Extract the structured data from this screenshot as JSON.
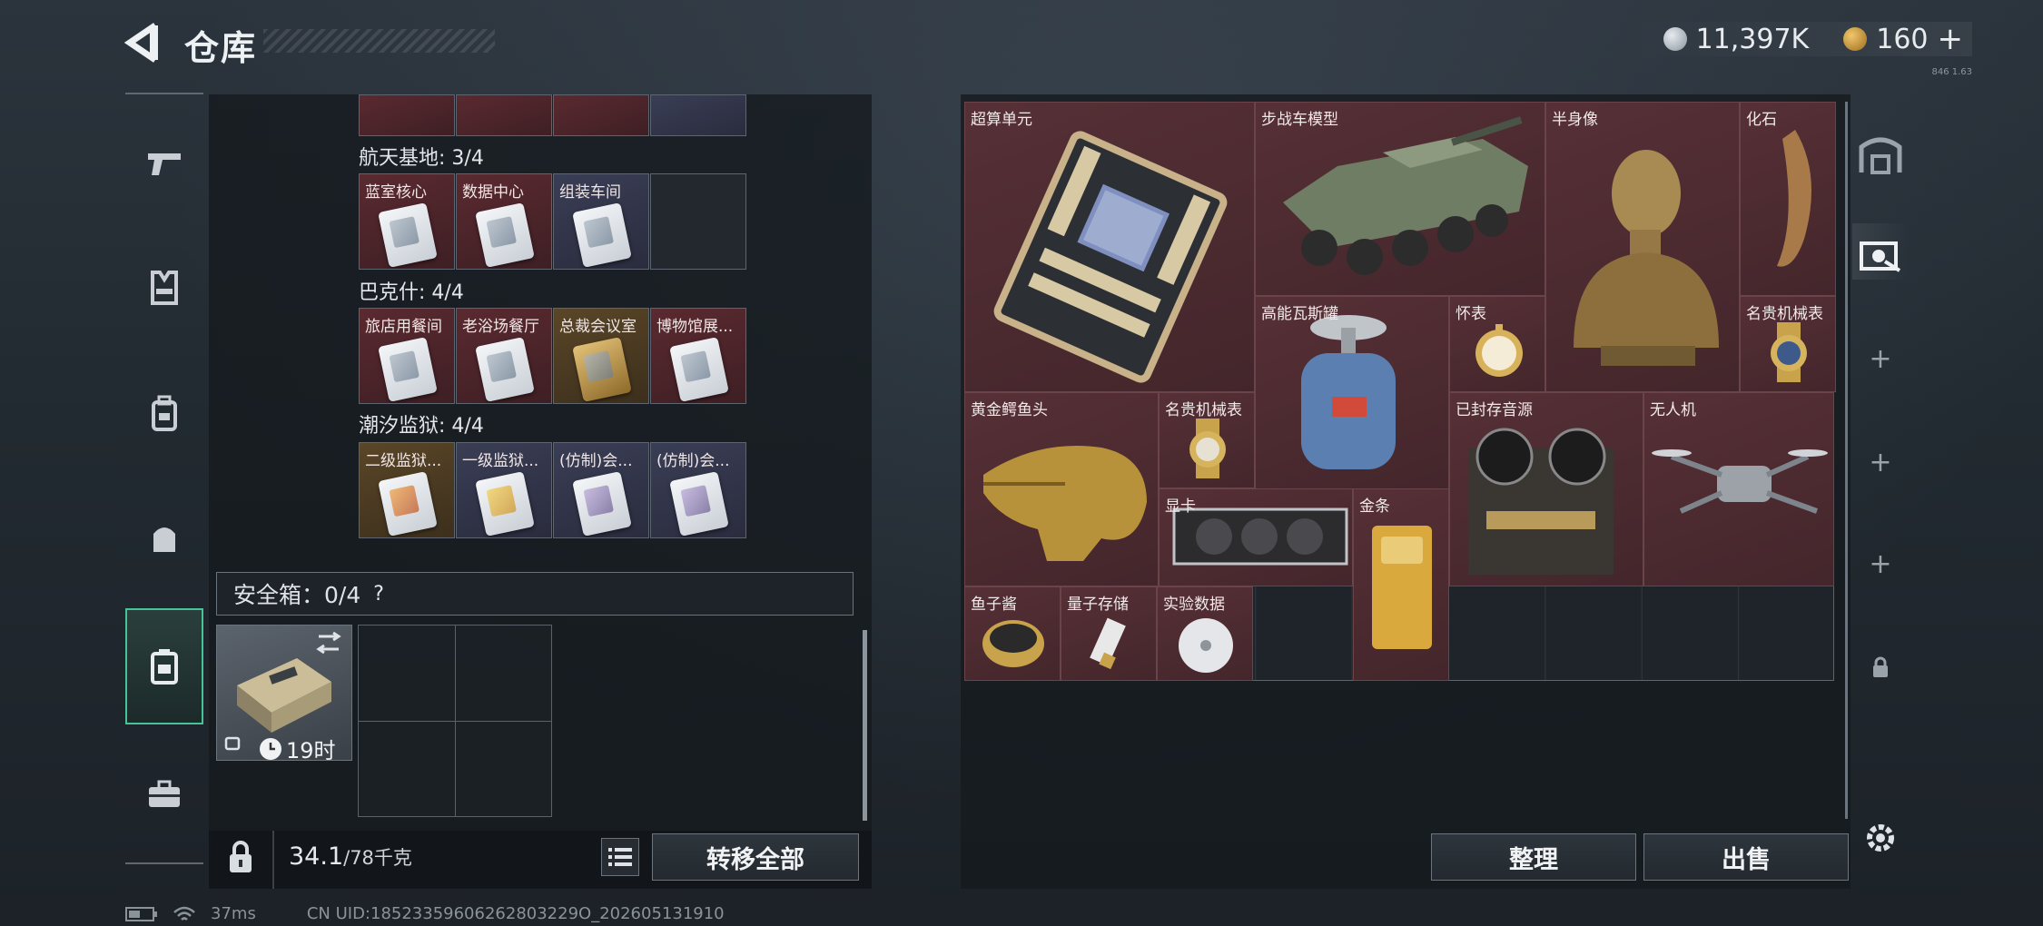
{
  "header": {
    "title": "仓库",
    "currency": {
      "silver": "11,397K",
      "gold": "160",
      "plus": "+"
    },
    "small_tag": "846 1.63"
  },
  "left_sidebar": {
    "items": [
      {
        "name": "weapons"
      },
      {
        "name": "armor-vest"
      },
      {
        "name": "backpack-rig"
      },
      {
        "name": "bag"
      },
      {
        "name": "safe-box"
      },
      {
        "name": "toolbox"
      }
    ],
    "active_index": 4
  },
  "stash": {
    "sections": [
      {
        "title": "航天基地: 3/4",
        "cards": [
          {
            "label": "蓝室核心",
            "color": "red",
            "card": "white"
          },
          {
            "label": "数据中心",
            "color": "red",
            "card": "white"
          },
          {
            "label": "组装车间",
            "color": "blue",
            "card": "white"
          },
          {
            "label": "",
            "color": "empty",
            "card": ""
          }
        ]
      },
      {
        "title": "巴克什: 4/4",
        "cards": [
          {
            "label": "旅店用餐间",
            "color": "red",
            "card": "white"
          },
          {
            "label": "老浴场餐厅",
            "color": "red",
            "card": "white"
          },
          {
            "label": "总裁会议室",
            "color": "gold",
            "card": "gold"
          },
          {
            "label": "博物馆展...",
            "color": "red",
            "card": "white"
          }
        ]
      },
      {
        "title": "潮汐监狱: 4/4",
        "cards": [
          {
            "label": "二级监狱...",
            "color": "gold",
            "card": "orange"
          },
          {
            "label": "一级监狱...",
            "color": "blue",
            "card": "yellow"
          },
          {
            "label": "(仿制)会...",
            "color": "blue",
            "card": "purple"
          },
          {
            "label": "(仿制)会...",
            "color": "blue",
            "card": "purple"
          }
        ]
      }
    ]
  },
  "safe_box": {
    "label": "安全箱：0/4",
    "help": "?",
    "item_timer": "19时"
  },
  "bottom_left": {
    "weight_value": "34.1",
    "weight_max": "/78千克",
    "transfer_all": "转移全部"
  },
  "warehouse_items": [
    {
      "label": "超算单元",
      "icon": "supercomputer-board-icon"
    },
    {
      "label": "步战车模型",
      "icon": "ifv-model-icon"
    },
    {
      "label": "半身像",
      "icon": "bust-statue-icon"
    },
    {
      "label": "化石",
      "icon": "fossil-claw-icon"
    },
    {
      "label": "高能瓦斯罐",
      "icon": "gas-canister-icon"
    },
    {
      "label": "怀表",
      "icon": "pocket-watch-icon"
    },
    {
      "label": "名贵机械表",
      "icon": "luxury-watch-icon"
    },
    {
      "label": "黄金鳄鱼头",
      "icon": "golden-croc-head-icon"
    },
    {
      "label": "名贵机械表",
      "icon": "luxury-watch-icon"
    },
    {
      "label": "已封存音源",
      "icon": "reel-recorder-icon"
    },
    {
      "label": "无人机",
      "icon": "drone-icon"
    },
    {
      "label": "显卡",
      "icon": "graphics-card-icon"
    },
    {
      "label": "金条",
      "icon": "gold-bar-icon"
    },
    {
      "label": "鱼子酱",
      "icon": "caviar-tin-icon"
    },
    {
      "label": "量子存储",
      "icon": "quantum-storage-icon"
    },
    {
      "label": "实验数据",
      "icon": "data-disc-icon"
    }
  ],
  "bottom_right": {
    "sort": "整理",
    "sell": "出售"
  },
  "right_rail": {
    "buttons": [
      "stash-tab-1",
      "stash-tab-2",
      "add-tab",
      "add-tab",
      "add-tab",
      "locked-tab"
    ],
    "settings": "gear"
  },
  "status_bar": {
    "ping": "37ms",
    "uid": "CN UID:18523359606262803229O_202605131910"
  }
}
